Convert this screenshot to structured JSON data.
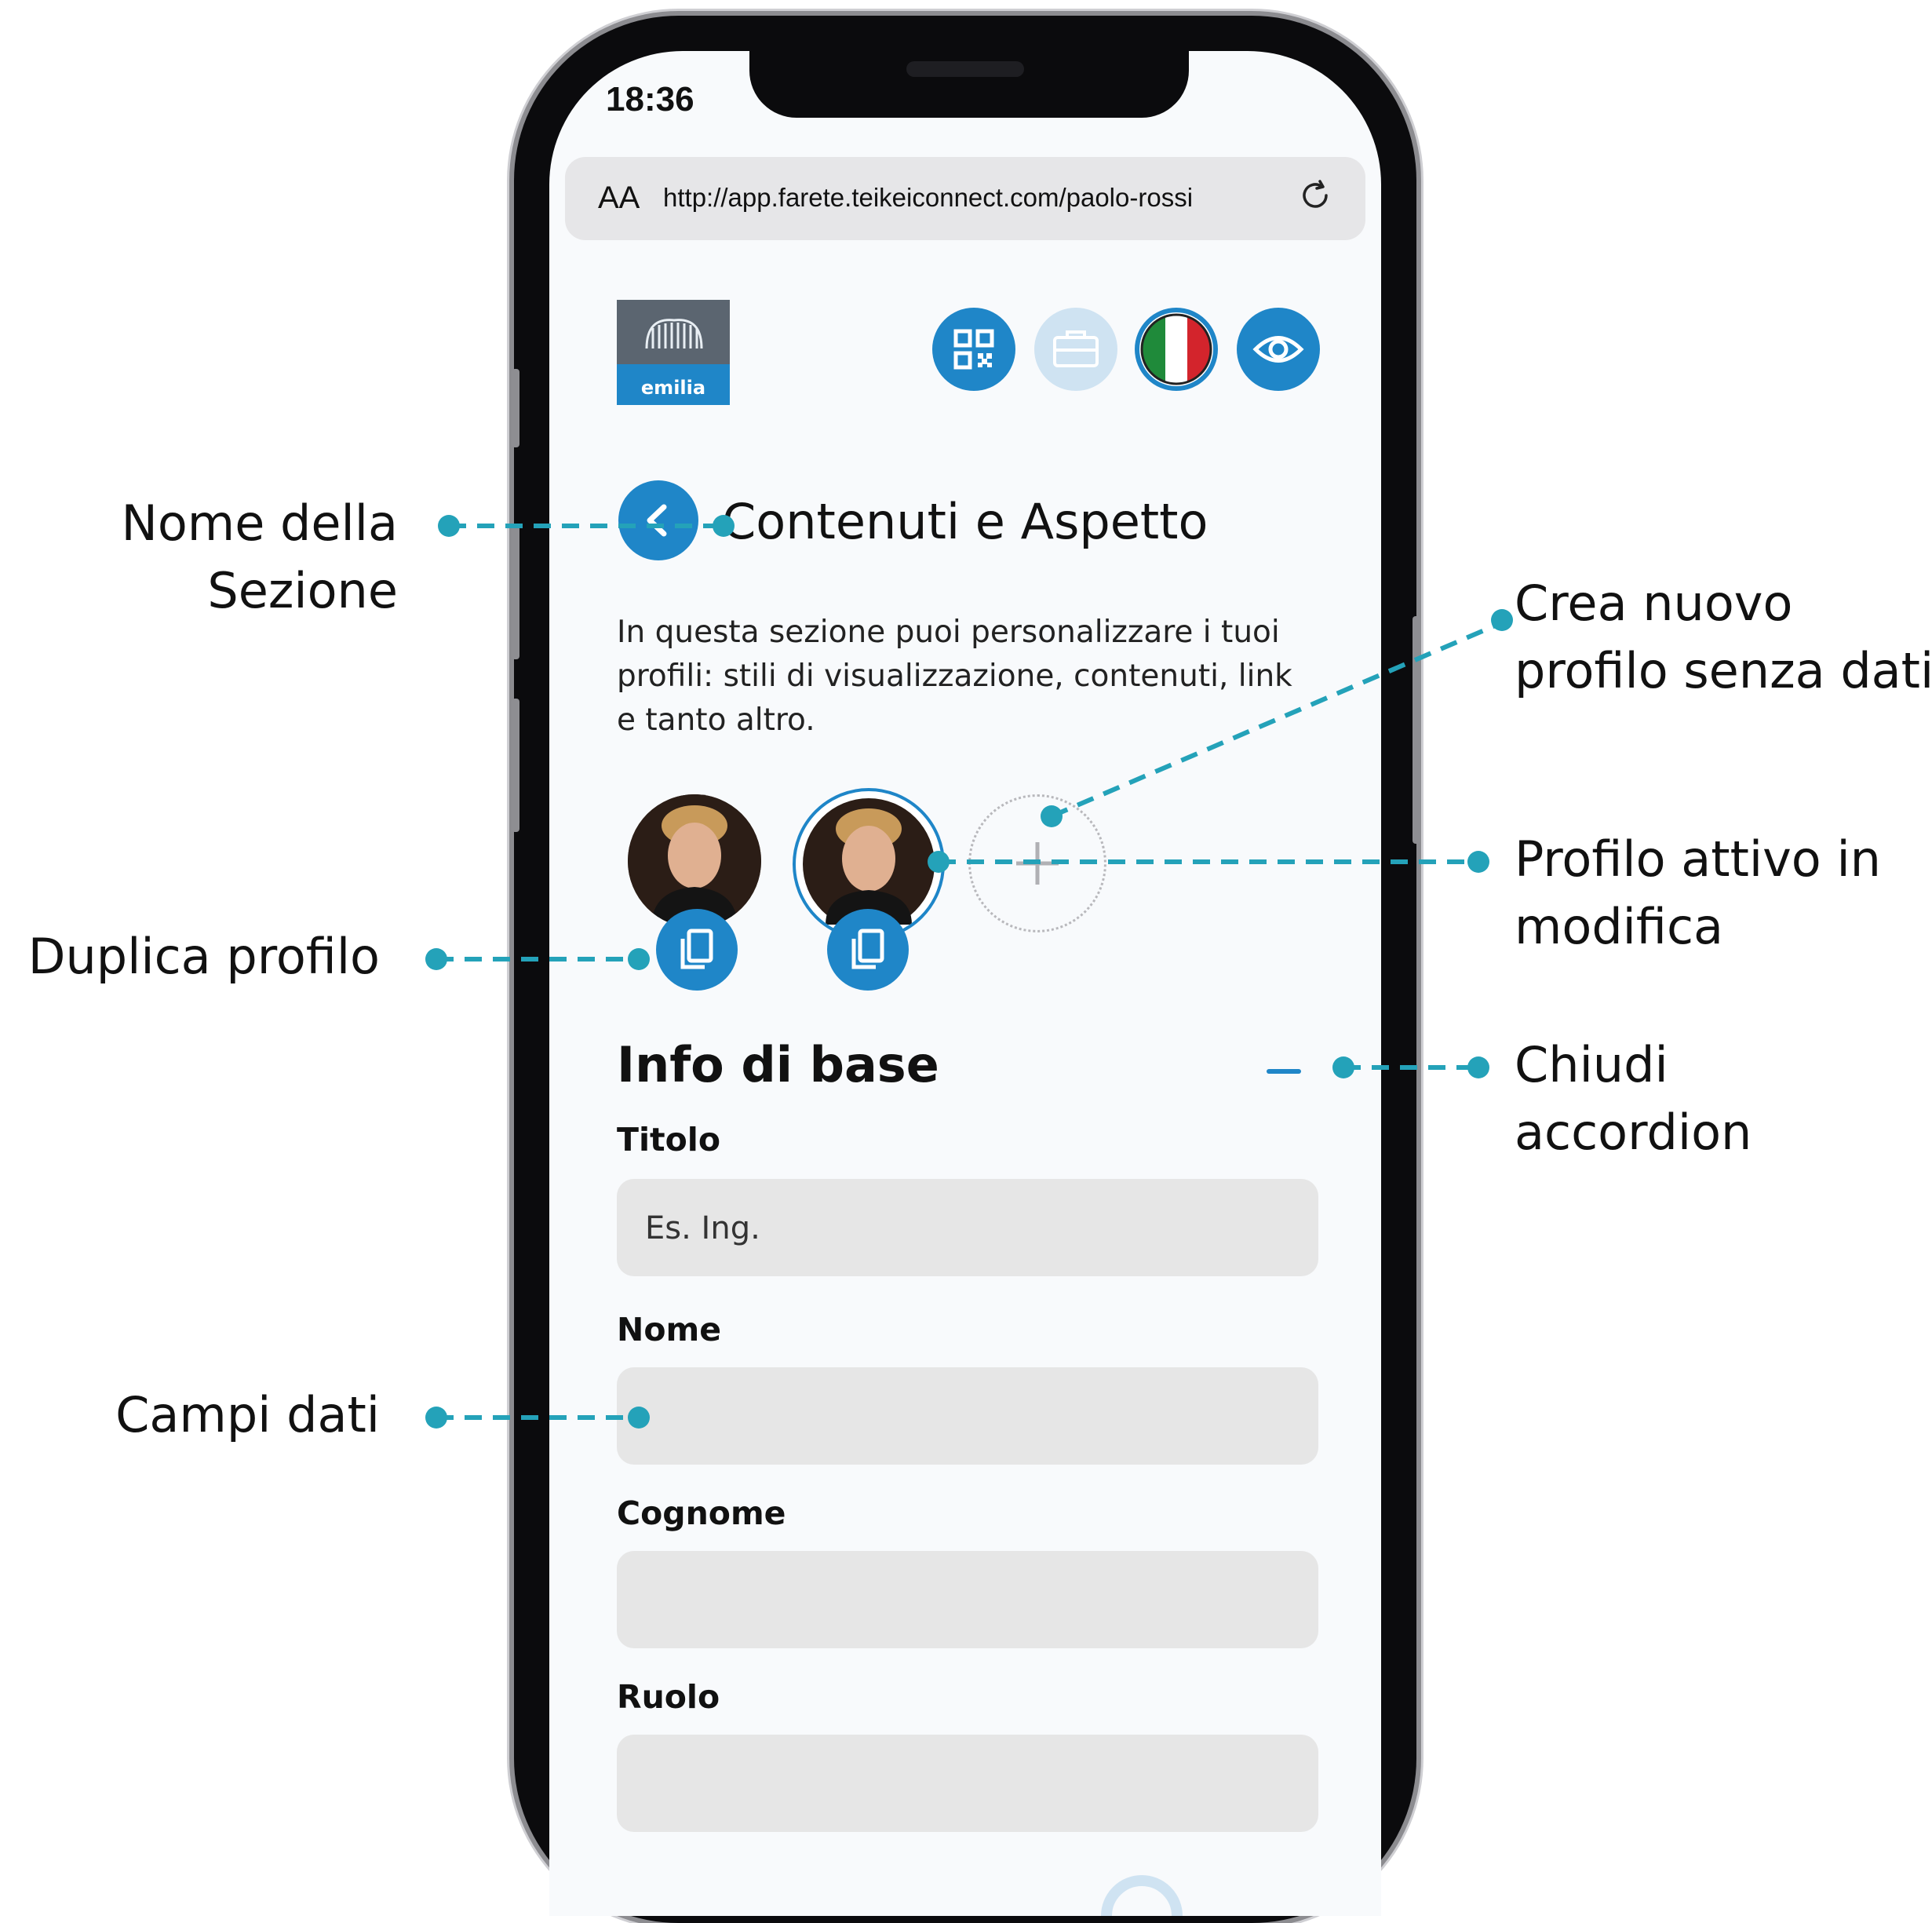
{
  "status_bar": {
    "time": "18:36"
  },
  "browser": {
    "text_size_label": "AA",
    "url": "http://app.farete.teikeiconnect.com/paolo-rossi"
  },
  "header": {
    "logo_text": "emilia"
  },
  "section": {
    "title": "Contenuti e Aspetto",
    "description": "In questa sezione puoi personalizzare i tuoi profili: stili di visualizzazione, contenuti, link e tanto altro."
  },
  "accordion": {
    "title": "Info di base"
  },
  "form": {
    "fields": [
      {
        "label": "Titolo",
        "placeholder": "Es. Ing."
      },
      {
        "label": "Nome",
        "placeholder": ""
      },
      {
        "label": "Cognome",
        "placeholder": ""
      },
      {
        "label": "Ruolo",
        "placeholder": ""
      }
    ]
  },
  "annotations": {
    "section_name": [
      "Nome della",
      "Sezione"
    ],
    "create_profile": [
      "Crea nuovo",
      "profilo senza dati"
    ],
    "active_profile": [
      "Profilo attivo in",
      "modifica"
    ],
    "duplicate": [
      "Duplica profilo"
    ],
    "close_accordion": [
      "Chiudi",
      "accordion"
    ],
    "data_fields": [
      "Campi dati"
    ]
  },
  "colors": {
    "accent": "#1f86c8",
    "annotation": "#24a2b9",
    "field_bg": "#e6e6e6"
  },
  "icons": [
    "refresh-icon",
    "qr-code-icon",
    "briefcase-icon",
    "italy-flag-icon",
    "eye-icon",
    "chevron-left-icon",
    "copy-icon",
    "plus-icon",
    "minus-icon"
  ]
}
